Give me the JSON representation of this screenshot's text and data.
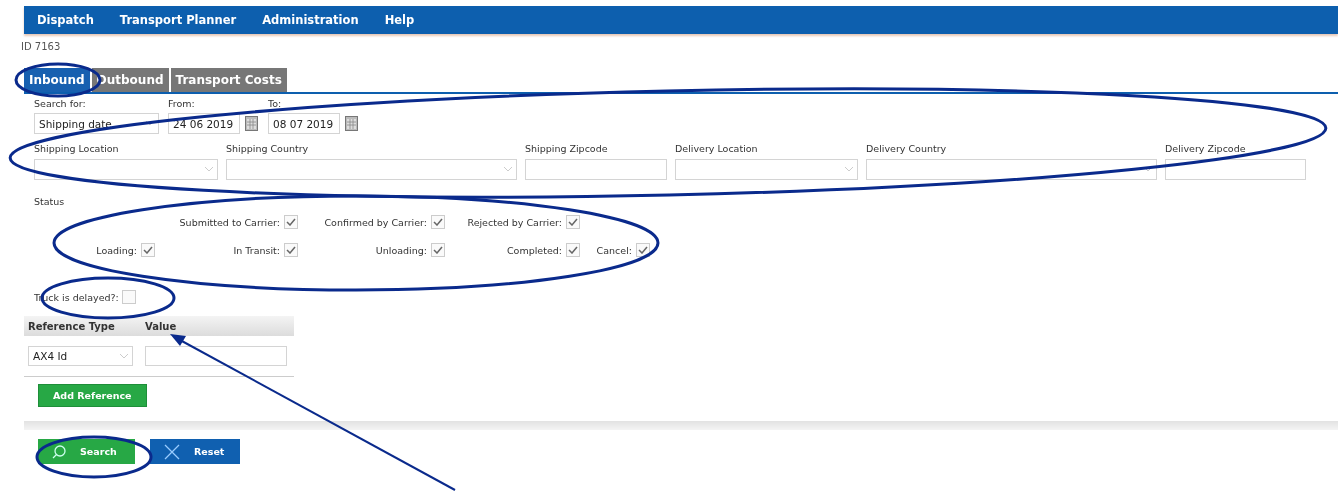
{
  "menu": [
    "Dispatch",
    "Transport Planner",
    "Administration",
    "Help"
  ],
  "record_id": "ID 7163",
  "tabs": [
    {
      "label": "Inbound",
      "selected": true
    },
    {
      "label": "Outbound",
      "selected": false
    },
    {
      "label": "Transport Costs",
      "selected": false
    }
  ],
  "search_for": {
    "label": "Search for:",
    "value": "Shipping date"
  },
  "from": {
    "label": "From:",
    "value": "24 06 2019"
  },
  "to": {
    "label": "To:",
    "value": "08 07 2019"
  },
  "location_fields": [
    {
      "label": "Shipping Location",
      "kind": "select"
    },
    {
      "label": "Shipping Country",
      "kind": "select"
    },
    {
      "label": "Shipping Zipcode",
      "kind": "text"
    },
    {
      "label": "Delivery Location",
      "kind": "select"
    },
    {
      "label": "Delivery Country",
      "kind": "select"
    },
    {
      "label": "Delivery Zipcode",
      "kind": "text"
    }
  ],
  "status": {
    "label": "Status",
    "rows": [
      [
        "",
        {
          "label": "Submitted to Carrier:",
          "checked": true
        },
        {
          "label": "Confirmed by Carrier:",
          "checked": true
        },
        {
          "label": "Rejected by Carrier:",
          "checked": true
        }
      ],
      [
        {
          "label": "Loading:",
          "checked": true
        },
        {
          "label": "In Transit:",
          "checked": true
        },
        {
          "label": "Unloading:",
          "checked": true
        },
        {
          "label": "Completed:",
          "checked": true
        },
        {
          "label": "Cancel:",
          "checked": true
        }
      ]
    ]
  },
  "truck_delayed": {
    "label": "Truck is delayed?:",
    "checked": false
  },
  "references": {
    "columns": [
      "Reference Type",
      "Value"
    ],
    "rows": [
      {
        "type": "AX4 Id"
      }
    ]
  },
  "add_reference": "Add Reference",
  "buttons": [
    {
      "label": "Search",
      "kind": "search"
    },
    {
      "label": "Reset",
      "kind": "reset"
    }
  ]
}
